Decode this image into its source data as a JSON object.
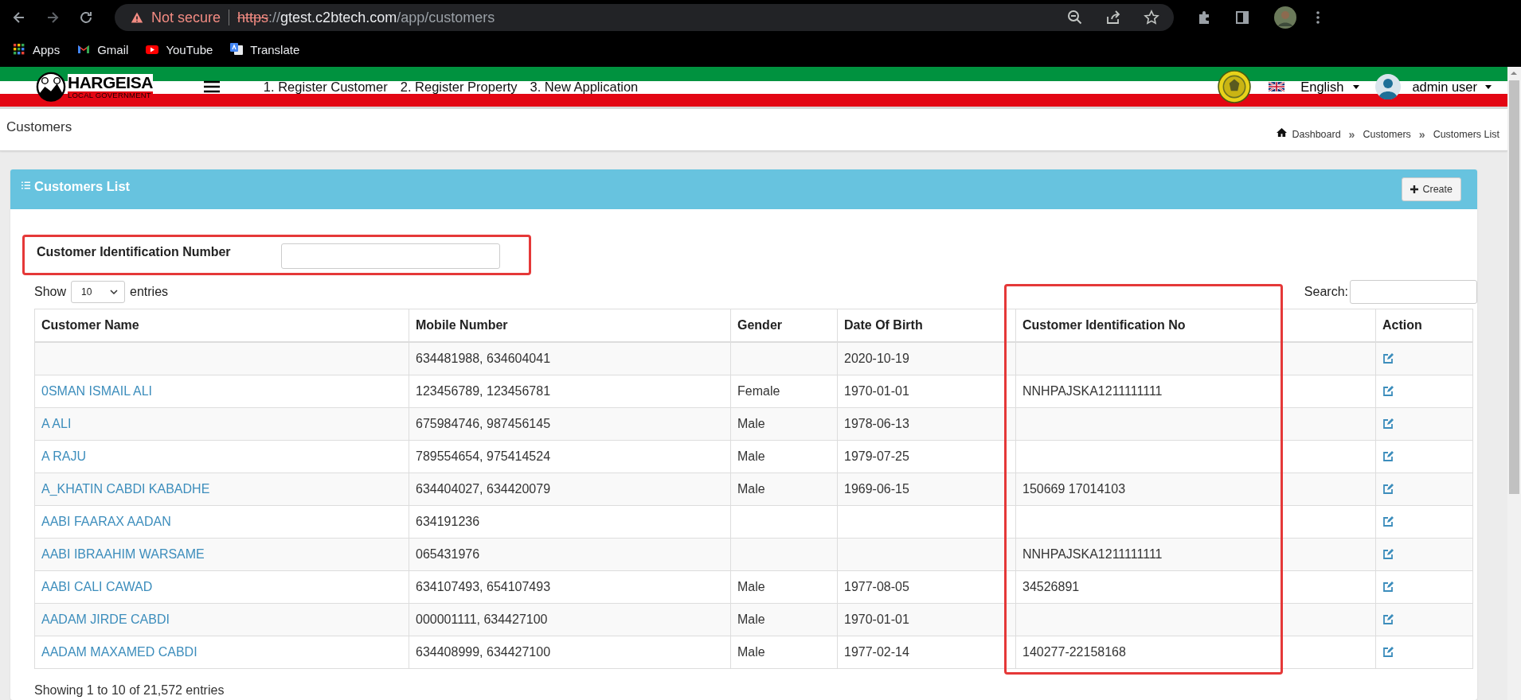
{
  "browser": {
    "security": "Not secure",
    "url_scheme": "https",
    "url_separator": "://",
    "url_host": "gtest.c2btech.com",
    "url_path": "/app/customers",
    "bookmarks": [
      {
        "kind": "apps",
        "label": "Apps"
      },
      {
        "kind": "gmail",
        "label": "Gmail"
      },
      {
        "kind": "youtube",
        "label": "YouTube"
      },
      {
        "kind": "translate",
        "label": "Translate"
      }
    ]
  },
  "header": {
    "logo_title": "HARGEISA",
    "logo_subtitle": "LOCAL GOVERNMENT",
    "nav": [
      "1. Register Customer",
      "2. Register Property",
      "3. New Application"
    ],
    "language": "English",
    "user": "admin user"
  },
  "page": {
    "title": "Customers",
    "breadcrumb": [
      {
        "kind": "link",
        "label": "Dashboard"
      },
      {
        "kind": "separator",
        "label": "»"
      },
      {
        "kind": "link",
        "label": "Customers"
      },
      {
        "kind": "separator",
        "label": "»"
      },
      {
        "kind": "link",
        "label": "Customers List"
      }
    ]
  },
  "panel": {
    "title": "Customers List",
    "create_button": "Create",
    "filter": {
      "label": "Customer Identification Number",
      "highlighted": true
    },
    "show_label": "Show",
    "page_size": "10",
    "entries_label": "entries",
    "search_label": "Search:",
    "table": {
      "columns": [
        {
          "label": "Customer Name",
          "highlighted": false
        },
        {
          "label": "Mobile Number",
          "highlighted": false
        },
        {
          "label": "Gender",
          "highlighted": false
        },
        {
          "label": "Date Of Birth",
          "highlighted": false
        },
        {
          "label": "Customer Identification No",
          "highlighted": true
        },
        {
          "label": "Action",
          "highlighted": false
        }
      ],
      "rows": [
        {
          "mobile": "634481988, 634604041",
          "dob": "2020-10-19"
        },
        {
          "name": "0SMAN ISMAIL ALI",
          "mobile": "123456789, 123456781",
          "gender": "Female",
          "dob": "1970-01-01",
          "cid": "NNHPAJSKA1211111111"
        },
        {
          "name": "A ALI",
          "mobile": "675984746, 987456145",
          "gender": "Male",
          "dob": "1978-06-13"
        },
        {
          "name": "A RAJU",
          "mobile": "789554654, 975414524",
          "gender": "Male",
          "dob": "1979-07-25"
        },
        {
          "name": "A_KHATIN CABDI KABADHE",
          "mobile": "634404027, 634420079",
          "gender": "Male",
          "dob": "1969-06-15",
          "cid": "150669 17014103"
        },
        {
          "name": "AABI FAARAX AADAN",
          "mobile": "634191236"
        },
        {
          "name": "AABI IBRAAHIM WARSAME",
          "mobile": "065431976",
          "cid": "NNHPAJSKA1211111111"
        },
        {
          "name": "AABI CALI CAWAD",
          "mobile": "634107493, 654107493",
          "gender": "Male",
          "dob": "1977-08-05",
          "cid": "34526891"
        },
        {
          "name": "AADAM JIRDE CABDI",
          "mobile": "000001111, 634427100",
          "gender": "Male",
          "dob": "1970-01-01"
        },
        {
          "name": "AADAM MAXAMED CABDI",
          "mobile": "634408999, 634427100",
          "gender": "Male",
          "dob": "1977-02-14",
          "cid": "140277-22158168"
        }
      ]
    },
    "info": "Showing 1 to 10 of 21,572 entries"
  }
}
